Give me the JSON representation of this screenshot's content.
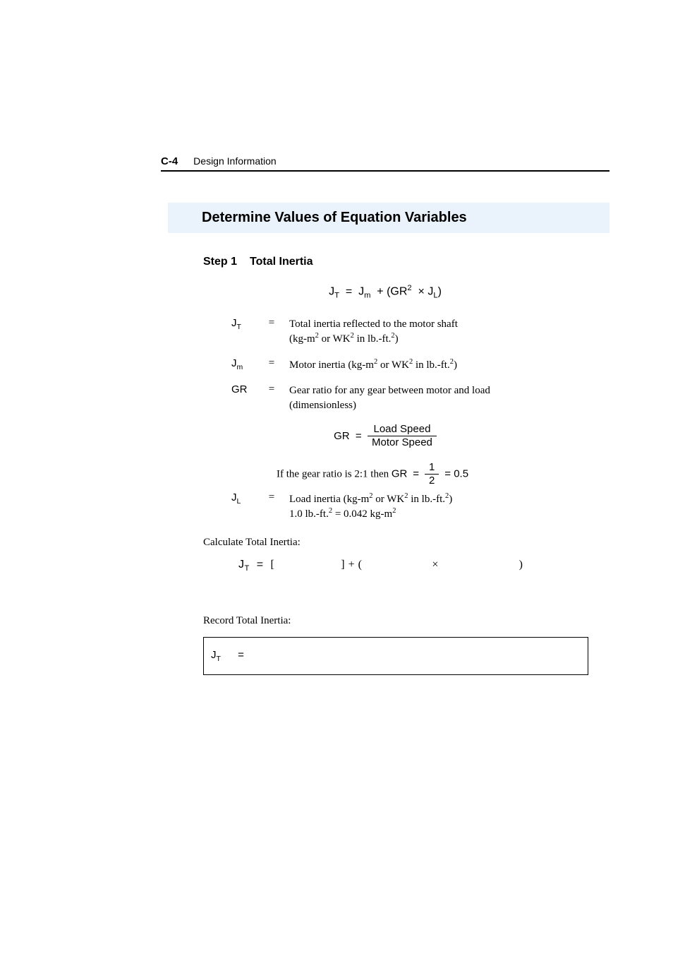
{
  "header": {
    "page_number": "C-4",
    "chapter_title": "Design Information"
  },
  "section": {
    "heading": "Determine Values of Equation Variables"
  },
  "step1": {
    "label": "Step 1",
    "title": "Total Inertia",
    "equation": {
      "lhs_var": "J",
      "lhs_sub": "T",
      "rhs_term1_var": "J",
      "rhs_term1_sub": "m",
      "gr": "GR",
      "gr_exp": "2",
      "jl_var": "J",
      "jl_sub": "L"
    },
    "defs": {
      "jt": {
        "sym_var": "J",
        "sym_sub": "T",
        "text_line1": "Total inertia reflected to the motor shaft",
        "text_line2_a": "(kg-m",
        "text_line2_b": " or WK",
        "text_line2_c": " in lb.-ft.",
        "text_line2_d": ")"
      },
      "jm": {
        "sym_var": "J",
        "sym_sub": "m",
        "text_a": "Motor inertia (kg-m",
        "text_b": " or WK",
        "text_c": " in lb.-ft.",
        "text_d": ")"
      },
      "gr": {
        "sym": "GR",
        "text_line1": "Gear ratio for any gear between motor and load",
        "text_line2": "(dimensionless)"
      },
      "gr_formula": {
        "lhs": "GR",
        "num": "Load Speed",
        "den": "Motor Speed"
      },
      "gr_example": {
        "prefix": "If the gear ratio is 2:1 then ",
        "lhs": "GR",
        "frac_num": "1",
        "frac_den": "2",
        "result": "0.5"
      },
      "jl": {
        "sym_var": "J",
        "sym_sub": "L",
        "text_a": "Load inertia (kg-m",
        "text_b": " or WK",
        "text_c": " in lb.-ft.",
        "text_d": ")",
        "conv_a": "1.0 lb.-ft.",
        "conv_b": " = 0.042 kg-m"
      }
    },
    "calc": {
      "label": "Calculate Total Inertia:",
      "lhs_var": "J",
      "lhs_sub": "T",
      "open": "[",
      "mid": "] + (",
      "times": "×",
      "close": ")"
    },
    "record": {
      "label": "Record Total Inertia:",
      "sym_var": "J",
      "sym_sub": "T",
      "eq": "="
    }
  }
}
